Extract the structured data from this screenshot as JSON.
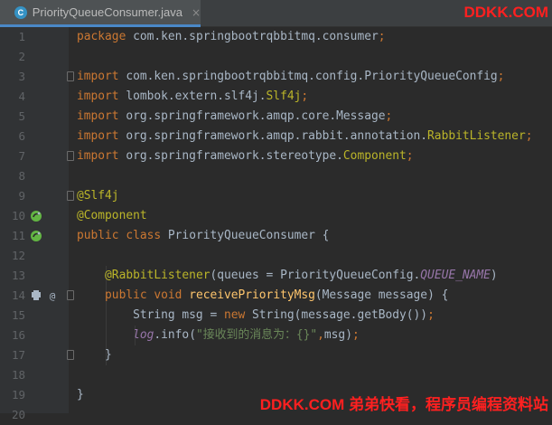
{
  "tab": {
    "icon_letter": "C",
    "title": "PriorityQueueConsumer.java",
    "close": "×"
  },
  "watermark_top": "DDKK.COM",
  "watermark_bottom": "DDKK.COM 弟弟快看，程序员编程资料站",
  "lines": [
    {
      "n": "1",
      "parts": [
        [
          "kw",
          "package "
        ],
        [
          "p",
          "com.ken.springbootrqbbitmq.consumer"
        ],
        [
          "kw",
          ";"
        ]
      ]
    },
    {
      "n": "2",
      "parts": []
    },
    {
      "n": "3",
      "parts": [
        [
          "kw",
          "import "
        ],
        [
          "p",
          "com.ken.springbootrqbbitmq.config.PriorityQueueConfig"
        ],
        [
          "kw",
          ";"
        ]
      ]
    },
    {
      "n": "4",
      "parts": [
        [
          "kw",
          "import "
        ],
        [
          "p",
          "lombok.extern.slf4j."
        ],
        [
          "ann",
          "Slf4j"
        ],
        [
          "kw",
          ";"
        ]
      ]
    },
    {
      "n": "5",
      "parts": [
        [
          "kw",
          "import "
        ],
        [
          "p",
          "org.springframework.amqp.core.Message"
        ],
        [
          "kw",
          ";"
        ]
      ]
    },
    {
      "n": "6",
      "parts": [
        [
          "kw",
          "import "
        ],
        [
          "p",
          "org.springframework.amqp.rabbit.annotation."
        ],
        [
          "ann",
          "RabbitListener"
        ],
        [
          "kw",
          ";"
        ]
      ]
    },
    {
      "n": "7",
      "parts": [
        [
          "kw",
          "import "
        ],
        [
          "p",
          "org.springframework.stereotype."
        ],
        [
          "ann",
          "Component"
        ],
        [
          "kw",
          ";"
        ]
      ]
    },
    {
      "n": "8",
      "parts": []
    },
    {
      "n": "9",
      "parts": [
        [
          "ann",
          "@Slf4j"
        ]
      ]
    },
    {
      "n": "10",
      "parts": [
        [
          "ann",
          "@Component"
        ]
      ]
    },
    {
      "n": "11",
      "parts": [
        [
          "kw",
          "public class "
        ],
        [
          "p",
          "PriorityQueueConsumer {"
        ]
      ]
    },
    {
      "n": "12",
      "parts": []
    },
    {
      "n": "13",
      "parts": [
        [
          "p",
          "    "
        ],
        [
          "ann",
          "@RabbitListener"
        ],
        [
          "p",
          "(queues = PriorityQueueConfig."
        ],
        [
          "const",
          "QUEUE_NAME"
        ],
        [
          "p",
          ")"
        ]
      ]
    },
    {
      "n": "14",
      "parts": [
        [
          "p",
          "    "
        ],
        [
          "kw",
          "public void "
        ],
        [
          "fn",
          "receivePriorityMsg"
        ],
        [
          "p",
          "(Message message) {"
        ]
      ]
    },
    {
      "n": "15",
      "parts": [
        [
          "p",
          "        String msg = "
        ],
        [
          "kw",
          "new "
        ],
        [
          "p",
          "String(message.getBody())"
        ],
        [
          "kw",
          ";"
        ]
      ]
    },
    {
      "n": "16",
      "parts": [
        [
          "p",
          "        "
        ],
        [
          "ital",
          "log"
        ],
        [
          "p",
          ".info("
        ],
        [
          "str",
          "\"接收到的消息为：{}\""
        ],
        [
          "kw",
          ","
        ],
        [
          "p",
          "msg)"
        ],
        [
          "kw",
          ";"
        ]
      ]
    },
    {
      "n": "17",
      "parts": [
        [
          "p",
          "    }"
        ]
      ]
    },
    {
      "n": "18",
      "parts": []
    },
    {
      "n": "19",
      "parts": [
        [
          "p",
          "}"
        ]
      ]
    },
    {
      "n": "20",
      "parts": []
    }
  ],
  "gutter_icons": {
    "10": "spring-bean-icon",
    "11": "spring-bean-icon",
    "14": "rabbit-listener-icon"
  }
}
